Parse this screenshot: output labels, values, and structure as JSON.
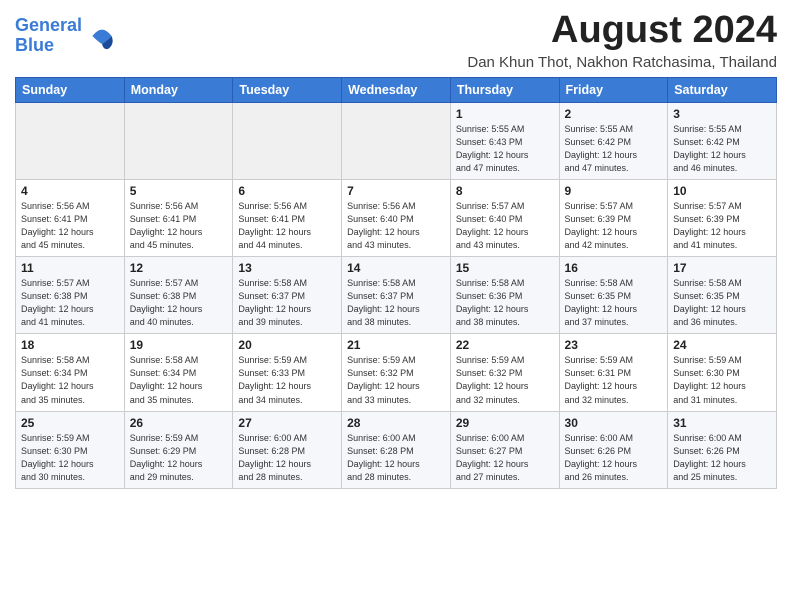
{
  "logo": {
    "line1": "General",
    "line2": "Blue"
  },
  "title": "August 2024",
  "location": "Dan Khun Thot, Nakhon Ratchasima, Thailand",
  "weekdays": [
    "Sunday",
    "Monday",
    "Tuesday",
    "Wednesday",
    "Thursday",
    "Friday",
    "Saturday"
  ],
  "weeks": [
    [
      {
        "day": "",
        "info": ""
      },
      {
        "day": "",
        "info": ""
      },
      {
        "day": "",
        "info": ""
      },
      {
        "day": "",
        "info": ""
      },
      {
        "day": "1",
        "info": "Sunrise: 5:55 AM\nSunset: 6:43 PM\nDaylight: 12 hours\nand 47 minutes."
      },
      {
        "day": "2",
        "info": "Sunrise: 5:55 AM\nSunset: 6:42 PM\nDaylight: 12 hours\nand 47 minutes."
      },
      {
        "day": "3",
        "info": "Sunrise: 5:55 AM\nSunset: 6:42 PM\nDaylight: 12 hours\nand 46 minutes."
      }
    ],
    [
      {
        "day": "4",
        "info": "Sunrise: 5:56 AM\nSunset: 6:41 PM\nDaylight: 12 hours\nand 45 minutes."
      },
      {
        "day": "5",
        "info": "Sunrise: 5:56 AM\nSunset: 6:41 PM\nDaylight: 12 hours\nand 45 minutes."
      },
      {
        "day": "6",
        "info": "Sunrise: 5:56 AM\nSunset: 6:41 PM\nDaylight: 12 hours\nand 44 minutes."
      },
      {
        "day": "7",
        "info": "Sunrise: 5:56 AM\nSunset: 6:40 PM\nDaylight: 12 hours\nand 43 minutes."
      },
      {
        "day": "8",
        "info": "Sunrise: 5:57 AM\nSunset: 6:40 PM\nDaylight: 12 hours\nand 43 minutes."
      },
      {
        "day": "9",
        "info": "Sunrise: 5:57 AM\nSunset: 6:39 PM\nDaylight: 12 hours\nand 42 minutes."
      },
      {
        "day": "10",
        "info": "Sunrise: 5:57 AM\nSunset: 6:39 PM\nDaylight: 12 hours\nand 41 minutes."
      }
    ],
    [
      {
        "day": "11",
        "info": "Sunrise: 5:57 AM\nSunset: 6:38 PM\nDaylight: 12 hours\nand 41 minutes."
      },
      {
        "day": "12",
        "info": "Sunrise: 5:57 AM\nSunset: 6:38 PM\nDaylight: 12 hours\nand 40 minutes."
      },
      {
        "day": "13",
        "info": "Sunrise: 5:58 AM\nSunset: 6:37 PM\nDaylight: 12 hours\nand 39 minutes."
      },
      {
        "day": "14",
        "info": "Sunrise: 5:58 AM\nSunset: 6:37 PM\nDaylight: 12 hours\nand 38 minutes."
      },
      {
        "day": "15",
        "info": "Sunrise: 5:58 AM\nSunset: 6:36 PM\nDaylight: 12 hours\nand 38 minutes."
      },
      {
        "day": "16",
        "info": "Sunrise: 5:58 AM\nSunset: 6:35 PM\nDaylight: 12 hours\nand 37 minutes."
      },
      {
        "day": "17",
        "info": "Sunrise: 5:58 AM\nSunset: 6:35 PM\nDaylight: 12 hours\nand 36 minutes."
      }
    ],
    [
      {
        "day": "18",
        "info": "Sunrise: 5:58 AM\nSunset: 6:34 PM\nDaylight: 12 hours\nand 35 minutes."
      },
      {
        "day": "19",
        "info": "Sunrise: 5:58 AM\nSunset: 6:34 PM\nDaylight: 12 hours\nand 35 minutes."
      },
      {
        "day": "20",
        "info": "Sunrise: 5:59 AM\nSunset: 6:33 PM\nDaylight: 12 hours\nand 34 minutes."
      },
      {
        "day": "21",
        "info": "Sunrise: 5:59 AM\nSunset: 6:32 PM\nDaylight: 12 hours\nand 33 minutes."
      },
      {
        "day": "22",
        "info": "Sunrise: 5:59 AM\nSunset: 6:32 PM\nDaylight: 12 hours\nand 32 minutes."
      },
      {
        "day": "23",
        "info": "Sunrise: 5:59 AM\nSunset: 6:31 PM\nDaylight: 12 hours\nand 32 minutes."
      },
      {
        "day": "24",
        "info": "Sunrise: 5:59 AM\nSunset: 6:30 PM\nDaylight: 12 hours\nand 31 minutes."
      }
    ],
    [
      {
        "day": "25",
        "info": "Sunrise: 5:59 AM\nSunset: 6:30 PM\nDaylight: 12 hours\nand 30 minutes."
      },
      {
        "day": "26",
        "info": "Sunrise: 5:59 AM\nSunset: 6:29 PM\nDaylight: 12 hours\nand 29 minutes."
      },
      {
        "day": "27",
        "info": "Sunrise: 6:00 AM\nSunset: 6:28 PM\nDaylight: 12 hours\nand 28 minutes."
      },
      {
        "day": "28",
        "info": "Sunrise: 6:00 AM\nSunset: 6:28 PM\nDaylight: 12 hours\nand 28 minutes."
      },
      {
        "day": "29",
        "info": "Sunrise: 6:00 AM\nSunset: 6:27 PM\nDaylight: 12 hours\nand 27 minutes."
      },
      {
        "day": "30",
        "info": "Sunrise: 6:00 AM\nSunset: 6:26 PM\nDaylight: 12 hours\nand 26 minutes."
      },
      {
        "day": "31",
        "info": "Sunrise: 6:00 AM\nSunset: 6:26 PM\nDaylight: 12 hours\nand 25 minutes."
      }
    ]
  ]
}
